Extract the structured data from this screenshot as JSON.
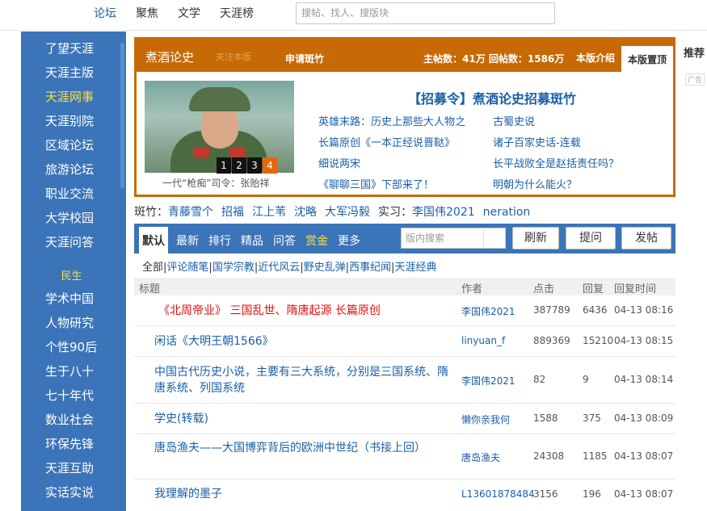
{
  "topnav": {
    "items": [
      "论坛",
      "聚焦",
      "文学",
      "天涯榜"
    ],
    "search_placeholder": "搜帖、找人、搜版块"
  },
  "sidebar": {
    "items": [
      "了望天涯",
      "天涯主版",
      "天涯网事",
      "天涯别院",
      "区域论坛",
      "旅游论坛",
      "职业交流",
      "大学校园",
      "天涯问答"
    ],
    "highlight_index": 2,
    "section_heading": "民生",
    "section_items": [
      "学术中国",
      "人物研究",
      "个性90后",
      "生于八十",
      "七十年代",
      "数业社会",
      "环保先锋",
      "天涯互助",
      "实话实说"
    ]
  },
  "forum": {
    "title": "煮酒论史",
    "follow_label": "关注本版",
    "apply_label": "申请斑竹",
    "stats": "主帖数：41万 回帖数：1586万",
    "tab_intro": "本版介绍",
    "tab_top": "本版置顶",
    "photo_caption": "一代“枪痴”司令：张贻祥",
    "slides": [
      "1",
      "2",
      "3",
      "4"
    ],
    "feature_title": "【招募令】煮酒论史招募斑竹",
    "links": [
      "英雄末路：历史上那些大人物之",
      "古蜀史说",
      "长篇原创《一本正经说晋鞑》",
      "诸子百家史话-连载",
      "细说两宋",
      "长平战败全是赵括责任吗？",
      "《聊聊三国》下部来了！",
      "明朝为什么能火？"
    ]
  },
  "moderators": {
    "label": "斑竹：",
    "names": [
      "青藤雪个",
      "招福",
      "江上苇",
      "沈略",
      "大军冯毅"
    ],
    "intern_label": "实习：",
    "interns": [
      "李国伟2021",
      "neration"
    ]
  },
  "tabs": {
    "items": [
      "默认",
      "最新",
      "排行",
      "精品",
      "问答",
      "赏金",
      "更多"
    ],
    "board_search_placeholder": "版内搜索",
    "refresh": "刷新",
    "ask": "提问",
    "post": "发帖"
  },
  "categories": {
    "all": "全部",
    "items": [
      "评论随笔",
      "国学宗教",
      "近代风云",
      "野史乱弹",
      "西事纪闻",
      "天涯经典"
    ]
  },
  "table": {
    "headers": [
      "标题",
      "作者",
      "点击",
      "回复",
      "回复时间"
    ],
    "rows": [
      {
        "title": "《北周帝业》 三国乱世、隋唐起源 长篇原创",
        "author": "李国伟2021",
        "clicks": "387789",
        "replies": "6436",
        "time": "04-13 08:16"
      },
      {
        "title": "闲话《大明王朝1566》",
        "author": "linyuan_f",
        "clicks": "889369",
        "replies": "15210",
        "time": "04-13 08:15"
      },
      {
        "title": "中国古代历史小说，主要有三大系统，分别是三国系统、隋唐系统、列国系统",
        "author": "李国伟2021",
        "clicks": "82",
        "replies": "9",
        "time": "04-13 08:14"
      },
      {
        "title": "学史(转载)",
        "author": "懒你亲我何",
        "clicks": "1588",
        "replies": "375",
        "time": "04-13 08:09"
      },
      {
        "title": "唐岛渔夫——大国博弈背后的欧洲中世纪（书接上回）",
        "author": "唐岛渔夫",
        "clicks": "24308",
        "replies": "1185",
        "time": "04-13 08:07"
      },
      {
        "title": "我理解的墨子",
        "author": "L13601878484",
        "clicks": "3156",
        "replies": "196",
        "time": "04-13 08:07"
      }
    ]
  },
  "right": {
    "recommend": "推荐",
    "ad": "广告"
  }
}
